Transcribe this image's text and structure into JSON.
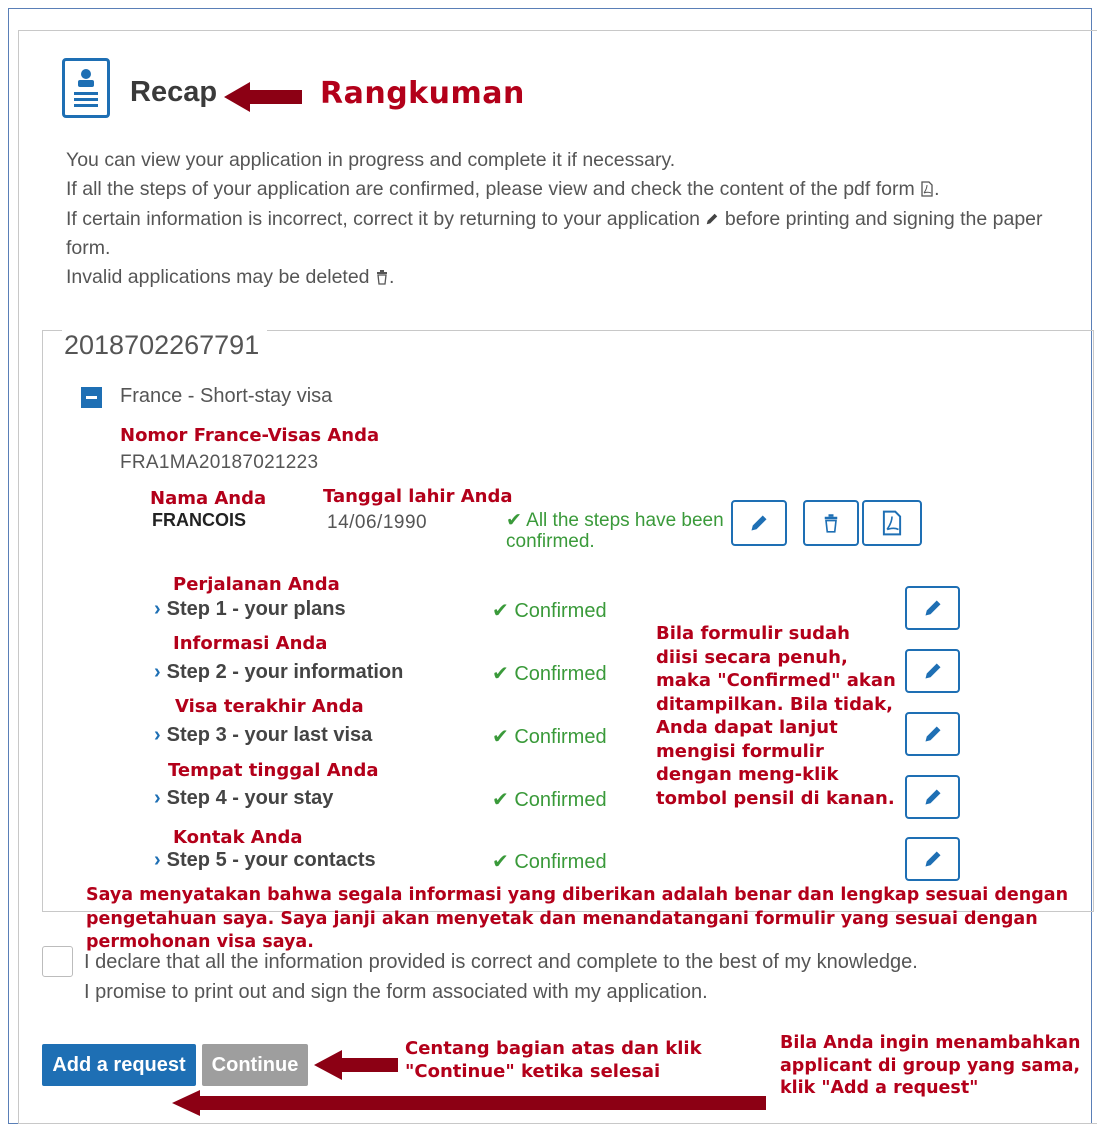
{
  "header": {
    "title": "Recap",
    "annotation": "Rangkuman"
  },
  "intro": {
    "line1": "You can view your application in progress and complete it if necessary.",
    "line2": "If all the steps of your application are confirmed, please view and check the content of the pdf form",
    "line3a": "If certain information is incorrect, correct it by returning to your application",
    "line3b": "before printing and signing the paper form.",
    "line4": "Invalid applications may be deleted"
  },
  "group": {
    "number": "2018702267791",
    "visa_type": "France - Short-stay visa",
    "label_number": "Nomor France-Visas Anda",
    "fv_number": "FRA1MA20187021223",
    "label_name": "Nama Anda",
    "name": "FRANCOIS",
    "label_dob": "Tanggal lahir Anda",
    "dob": "14/06/1990",
    "all_steps_status": "All the steps have been confirmed."
  },
  "steps": [
    {
      "annotation": "Perjalanan Anda",
      "label": "Step 1 - your plans",
      "status": "Confirmed"
    },
    {
      "annotation": "Informasi Anda",
      "label": "Step 2 - your information",
      "status": "Confirmed"
    },
    {
      "annotation": "Visa terakhir Anda",
      "label": "Step 3 - your last visa",
      "status": "Confirmed"
    },
    {
      "annotation": "Tempat tinggal Anda",
      "label": "Step 4 - your stay",
      "status": "Confirmed"
    },
    {
      "annotation": "Kontak Anda",
      "label": "Step 5 - your contacts",
      "status": "Confirmed"
    }
  ],
  "explain_annotation": "Bila formulir sudah diisi secara penuh, maka \"Confirmed\" akan ditampilkan. Bila tidak, Anda dapat lanjut mengisi formulir dengan meng-klik tombol pensil di kanan.",
  "declaration": {
    "annotation": "Saya menyatakan bahwa segala informasi yang diberikan adalah benar dan lengkap sesuai dengan pengetahuan saya. Saya janji akan menyetak dan menandatangani formulir yang sesuai dengan permohonan visa saya.",
    "line1": "I declare that all the information provided is correct and complete to the best of my knowledge.",
    "line2": "I promise to print out and sign the form associated with my application."
  },
  "buttons": {
    "add": "Add a request",
    "continue": "Continue"
  },
  "annotations": {
    "continue": "Centang bagian atas dan klik \"Continue\" ketika selesai",
    "add": "Bila Anda ingin menambahkan applicant di group yang sama, klik \"Add a request\""
  },
  "colors": {
    "primary": "#1e6fb4",
    "annotation_red": "#b3001a",
    "confirmed_green": "#3a9a3a",
    "disabled_gray": "#9e9e9e"
  }
}
